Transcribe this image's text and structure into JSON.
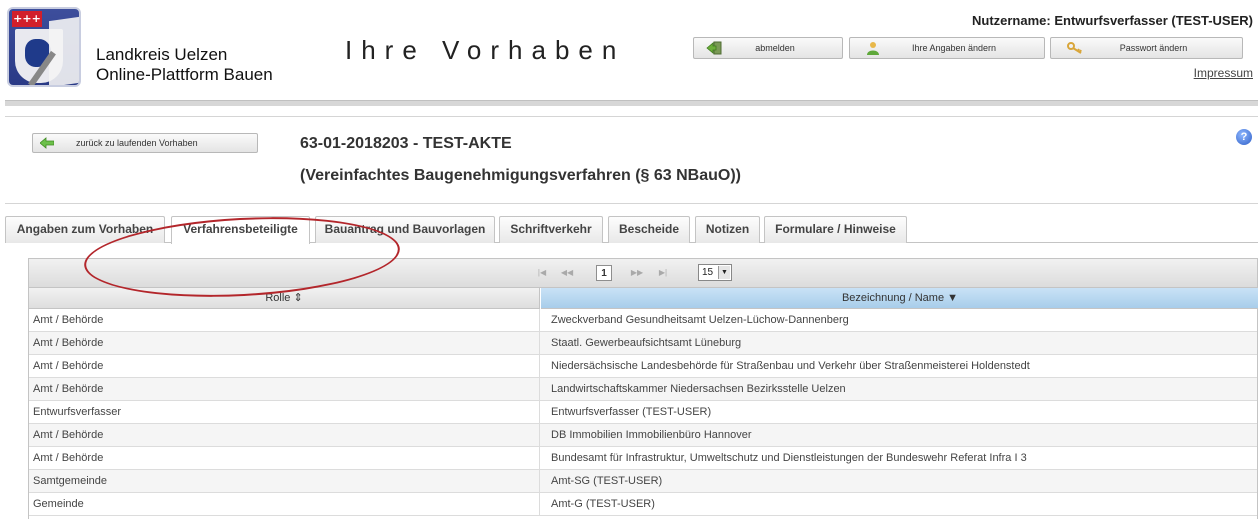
{
  "header": {
    "org_line1": "Landkreis Uelzen",
    "org_line2": "Online-Plattform Bauen",
    "logo_crosses": "+++",
    "title": "Ihre Vorhaben",
    "username": "Nutzername: Entwurfsverfasser (TEST-USER)",
    "buttons": {
      "logout": "abmelden",
      "edit_profile": "Ihre Angaben ändern",
      "change_password": "Passwort ändern"
    },
    "impressum": "Impressum"
  },
  "case": {
    "back_label": "zurück zu laufenden Vorhaben",
    "id_line": "63-01-2018203 - TEST-AKTE",
    "type_line": "(Vereinfachtes Baugenehmigungsverfahren (§ 63 NBauO))",
    "help": "?"
  },
  "tabs": [
    {
      "label": "Angaben zum Vorhaben"
    },
    {
      "label": "Verfahrensbeteiligte"
    },
    {
      "label": "Bauantrag und Bauvorlagen"
    },
    {
      "label": "Schriftverkehr"
    },
    {
      "label": "Bescheide"
    },
    {
      "label": "Notizen"
    },
    {
      "label": "Formulare / Hinweise"
    }
  ],
  "active_tab": "Verfahrensbeteiligte",
  "pager": {
    "first": "|◀",
    "prev": "◀◀",
    "page": "1",
    "next": "▶▶",
    "last": "▶|",
    "rows_per_page": "15"
  },
  "table": {
    "columns": [
      "Rolle ⇕",
      "Bezeichnung / Name ▼"
    ],
    "rows": [
      [
        "Amt / Behörde",
        "Zweckverband Gesundheitsamt Uelzen-Lüchow-Dannenberg"
      ],
      [
        "Amt / Behörde",
        "Staatl. Gewerbeaufsichtsamt Lüneburg"
      ],
      [
        "Amt / Behörde",
        "Niedersächsische Landesbehörde für Straßenbau und Verkehr über Straßenmeisterei Holdenstedt"
      ],
      [
        "Amt / Behörde",
        "Landwirtschaftskammer Niedersachsen Bezirksstelle Uelzen"
      ],
      [
        "Entwurfsverfasser",
        "Entwurfsverfasser (TEST-USER)"
      ],
      [
        "Amt / Behörde",
        "DB Immobilien Immobilienbüro Hannover"
      ],
      [
        "Amt / Behörde",
        "Bundesamt für Infrastruktur, Umweltschutz und Dienstleistungen der Bundeswehr Referat Infra I 3"
      ],
      [
        "Samtgemeinde",
        "Amt-SG (TEST-USER)"
      ],
      [
        "Gemeinde",
        "Amt-G (TEST-USER)"
      ]
    ]
  },
  "colors": {
    "annotation": "#b3262b",
    "sorted_header": "#b9d8f0",
    "logo_blue": "#2a3a86"
  }
}
